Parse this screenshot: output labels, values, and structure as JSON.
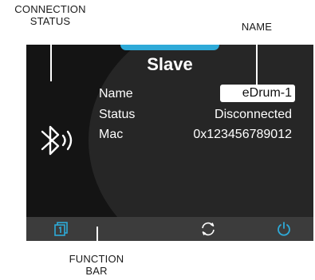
{
  "callouts": {
    "connection_status": [
      "CONNECTION",
      "STATUS"
    ],
    "name": "NAME",
    "function_bar": [
      "FUNCTION",
      "BAR"
    ]
  },
  "screen": {
    "title": "Slave",
    "fields": {
      "name_label": "Name",
      "name_value": "eDrum-1",
      "status_label": "Status",
      "status_value": "Disconnected",
      "mac_label": "Mac",
      "mac_value": "0x123456789012"
    },
    "status_icon": "bluetooth-signal-icon"
  },
  "function_bar": {
    "icons": [
      "page-1-icon",
      "refresh-icon",
      "power-icon"
    ],
    "accent": "#2eaad8"
  },
  "colors": {
    "screen_bg": "#141414",
    "accent": "#2eaad8",
    "bar_bg": "#3c3c3c"
  }
}
